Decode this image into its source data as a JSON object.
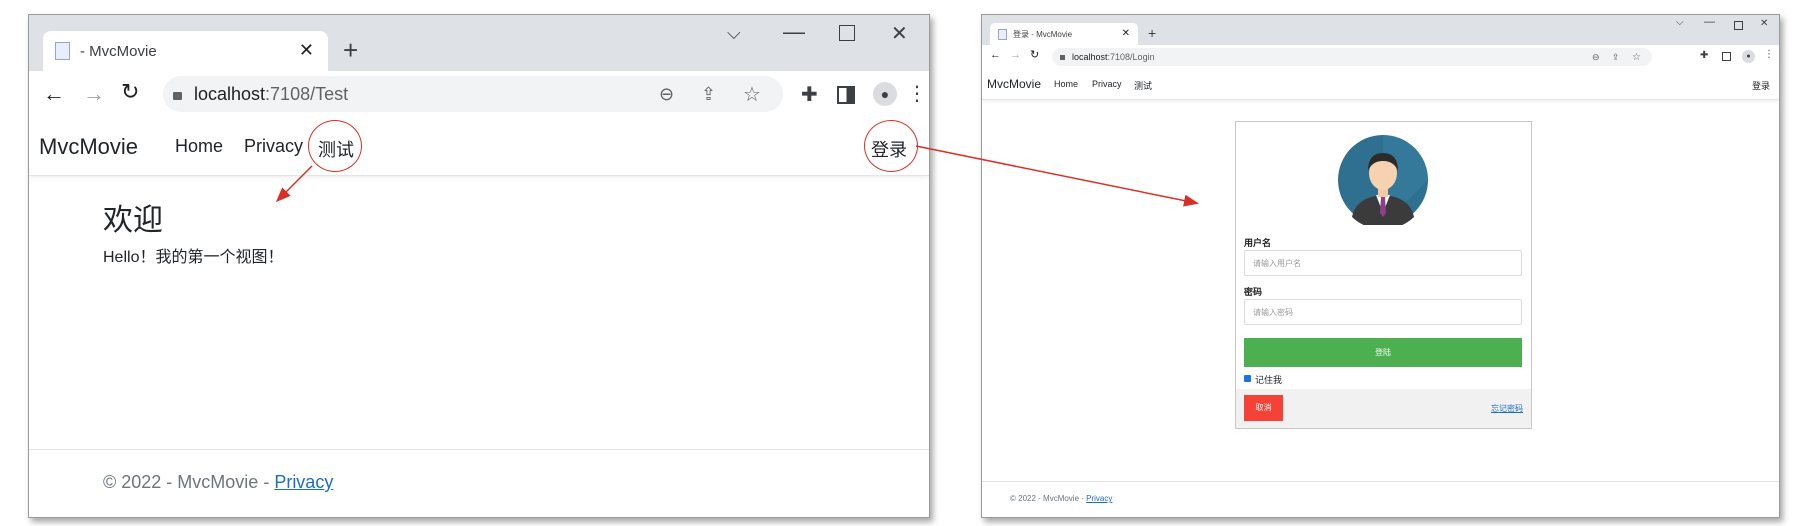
{
  "left": {
    "tab_title": "- MvcMovie",
    "url_host": "localhost",
    "url_path": ":7108/Test",
    "brand": "MvcMovie",
    "nav": [
      "Home",
      "Privacy",
      "测试"
    ],
    "login": "登录",
    "heading": "欢迎",
    "text": "Hello！我的第一个视图！",
    "footer_text": "© 2022 - MvcMovie - ",
    "footer_link": "Privacy"
  },
  "right": {
    "tab_title": "登录 - MvcMovie",
    "url_host": "localhost",
    "url_path": ":7108/Login",
    "brand": "MvcMovie",
    "nav": [
      "Home",
      "Privacy",
      "测试"
    ],
    "login": "登录",
    "form": {
      "username_label": "用户名",
      "username_placeholder": "请输入用户名",
      "password_label": "密码",
      "password_placeholder": "请输入密码",
      "submit": "登陆",
      "remember": "记住我",
      "cancel": "取消",
      "forgot": "忘记密码"
    },
    "footer_text": "© 2022 - MvcMovie - ",
    "footer_link": "Privacy"
  },
  "colors": {
    "annotation": "#d93025",
    "submit_green": "#4caf50",
    "cancel_red": "#f44336",
    "link_blue": "#1b6ec2"
  },
  "icons": [
    "new-tab-icon",
    "back-icon",
    "forward-icon",
    "reload-icon",
    "lock-icon",
    "zoom-icon",
    "share-icon",
    "star-icon",
    "extensions-icon",
    "sidepanel-icon",
    "profile-icon",
    "menu-icon",
    "minimize-icon",
    "maximize-icon",
    "close-icon",
    "tab-search-icon",
    "avatar-icon"
  ]
}
